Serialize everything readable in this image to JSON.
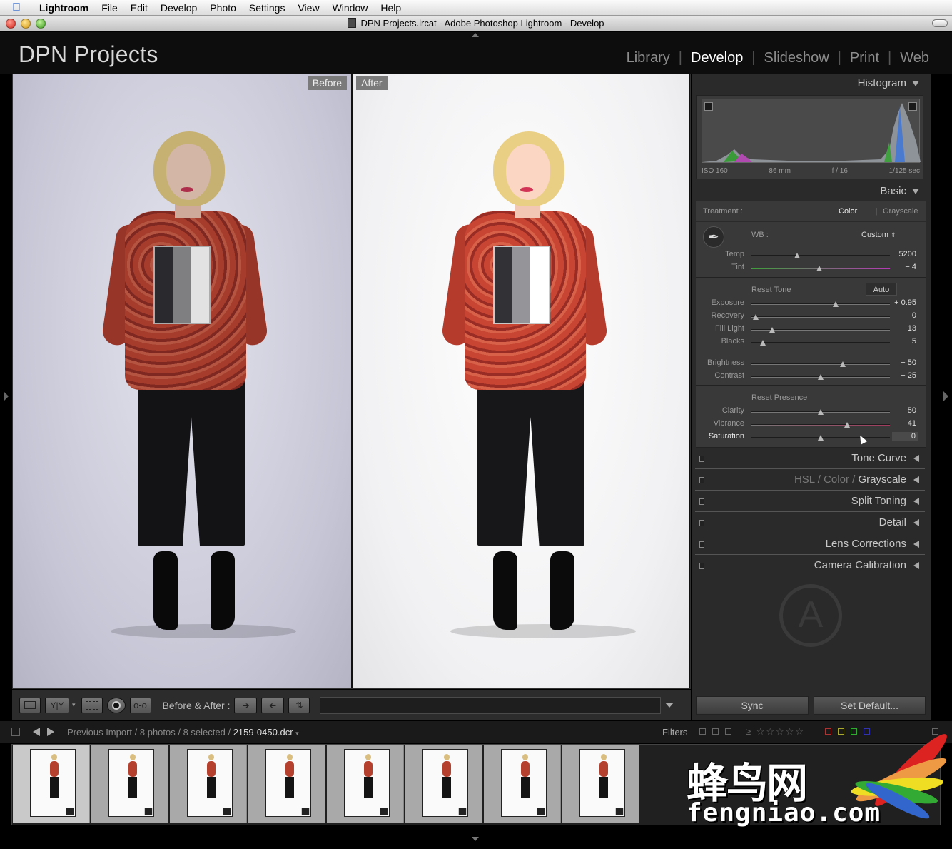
{
  "menubar": {
    "app": "Lightroom",
    "items": [
      "File",
      "Edit",
      "Develop",
      "Photo",
      "Settings",
      "View",
      "Window",
      "Help"
    ]
  },
  "window": {
    "title": "DPN Projects.lrcat - Adobe Photoshop Lightroom - Develop"
  },
  "header": {
    "catalog_name": "DPN Projects",
    "modules": [
      {
        "label": "Library",
        "active": false
      },
      {
        "label": "Develop",
        "active": true
      },
      {
        "label": "Slideshow",
        "active": false
      },
      {
        "label": "Print",
        "active": false
      },
      {
        "label": "Web",
        "active": false
      }
    ]
  },
  "view": {
    "before_label": "Before",
    "after_label": "After"
  },
  "toolbar": {
    "before_after_label": "Before & After :"
  },
  "histogram": {
    "title": "Histogram",
    "iso": "ISO 160",
    "focal": "86 mm",
    "aperture": "f / 16",
    "shutter": "1/125 sec"
  },
  "basic": {
    "title": "Basic",
    "treatment_label": "Treatment :",
    "treatment_color": "Color",
    "treatment_grayscale": "Grayscale",
    "wb_label": "WB :",
    "wb_value": "Custom",
    "reset_tone": "Reset Tone",
    "auto": "Auto",
    "reset_presence": "Reset Presence",
    "sliders": [
      {
        "key": "temp",
        "label": "Temp",
        "value": "5200",
        "pos": 0.33
      },
      {
        "key": "tint",
        "label": "Tint",
        "value": "− 4",
        "pos": 0.49
      },
      {
        "key": "exposure",
        "label": "Exposure",
        "value": "+ 0.95",
        "pos": 0.61
      },
      {
        "key": "recovery",
        "label": "Recovery",
        "value": "0",
        "pos": 0.03
      },
      {
        "key": "filllight",
        "label": "Fill Light",
        "value": "13",
        "pos": 0.15
      },
      {
        "key": "blacks",
        "label": "Blacks",
        "value": "5",
        "pos": 0.08
      },
      {
        "key": "brightness",
        "label": "Brightness",
        "value": "+ 50",
        "pos": 0.66
      },
      {
        "key": "contrast",
        "label": "Contrast",
        "value": "+ 25",
        "pos": 0.5
      },
      {
        "key": "clarity",
        "label": "Clarity",
        "value": "50",
        "pos": 0.5
      },
      {
        "key": "vibrance",
        "label": "Vibrance",
        "value": "+ 41",
        "pos": 0.69
      },
      {
        "key": "saturation",
        "label": "Saturation",
        "value": "0",
        "pos": 0.5
      }
    ]
  },
  "panels": {
    "tone_curve": "Tone Curve",
    "hsl": "HSL",
    "hsl_sep": "/",
    "color": "Color",
    "grayscale": "Grayscale",
    "split_toning": "Split Toning",
    "detail": "Detail",
    "lens_corrections": "Lens Corrections",
    "camera_calibration": "Camera Calibration"
  },
  "actions": {
    "sync": "Sync",
    "set_default": "Set Default..."
  },
  "filmstrip": {
    "path_prefix": "Previous Import / 8 photos / 8 selected /",
    "filename": "2159-0450.dcr",
    "filters_label": "Filters",
    "stars": "≥ ☆☆☆☆☆",
    "thumbnail_count": 8
  },
  "watermark": {
    "cn": "蜂鸟网",
    "en": "fengniao.com"
  },
  "colors": {
    "active_module": "#ffffff",
    "inactive_module": "#8c8c8c",
    "panel_bg": "#2a2a2a"
  }
}
